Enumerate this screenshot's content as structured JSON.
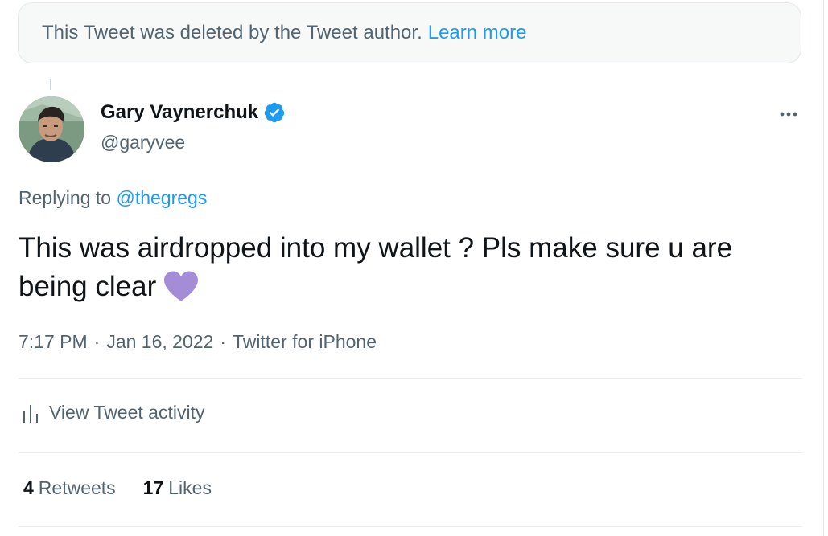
{
  "deleted_notice": {
    "text": "This Tweet was deleted by the Tweet author.",
    "link_label": "Learn more"
  },
  "author": {
    "name": "Gary Vaynerchuk",
    "handle": "@garyvee",
    "verified_icon": "verified-badge-icon"
  },
  "reply": {
    "prefix": "Replying to",
    "mention": "@thegregs"
  },
  "tweet": {
    "text": "This was airdropped into my wallet ? Pls make sure u are being clear",
    "emoji_icon": "purple-heart-icon"
  },
  "meta": {
    "time": "7:17 PM",
    "separator": "·",
    "date": "Jan 16, 2022",
    "source": "Twitter for iPhone"
  },
  "activity": {
    "label": "View Tweet activity",
    "icon": "analytics-bars-icon"
  },
  "stats": {
    "retweets_count": "4",
    "retweets_label": "Retweets",
    "likes_count": "17",
    "likes_label": "Likes"
  },
  "colors": {
    "accent": "#1d9bf0",
    "secondary_text": "#536471",
    "primary_text": "#0f1419",
    "heart": "#a48cd6"
  }
}
